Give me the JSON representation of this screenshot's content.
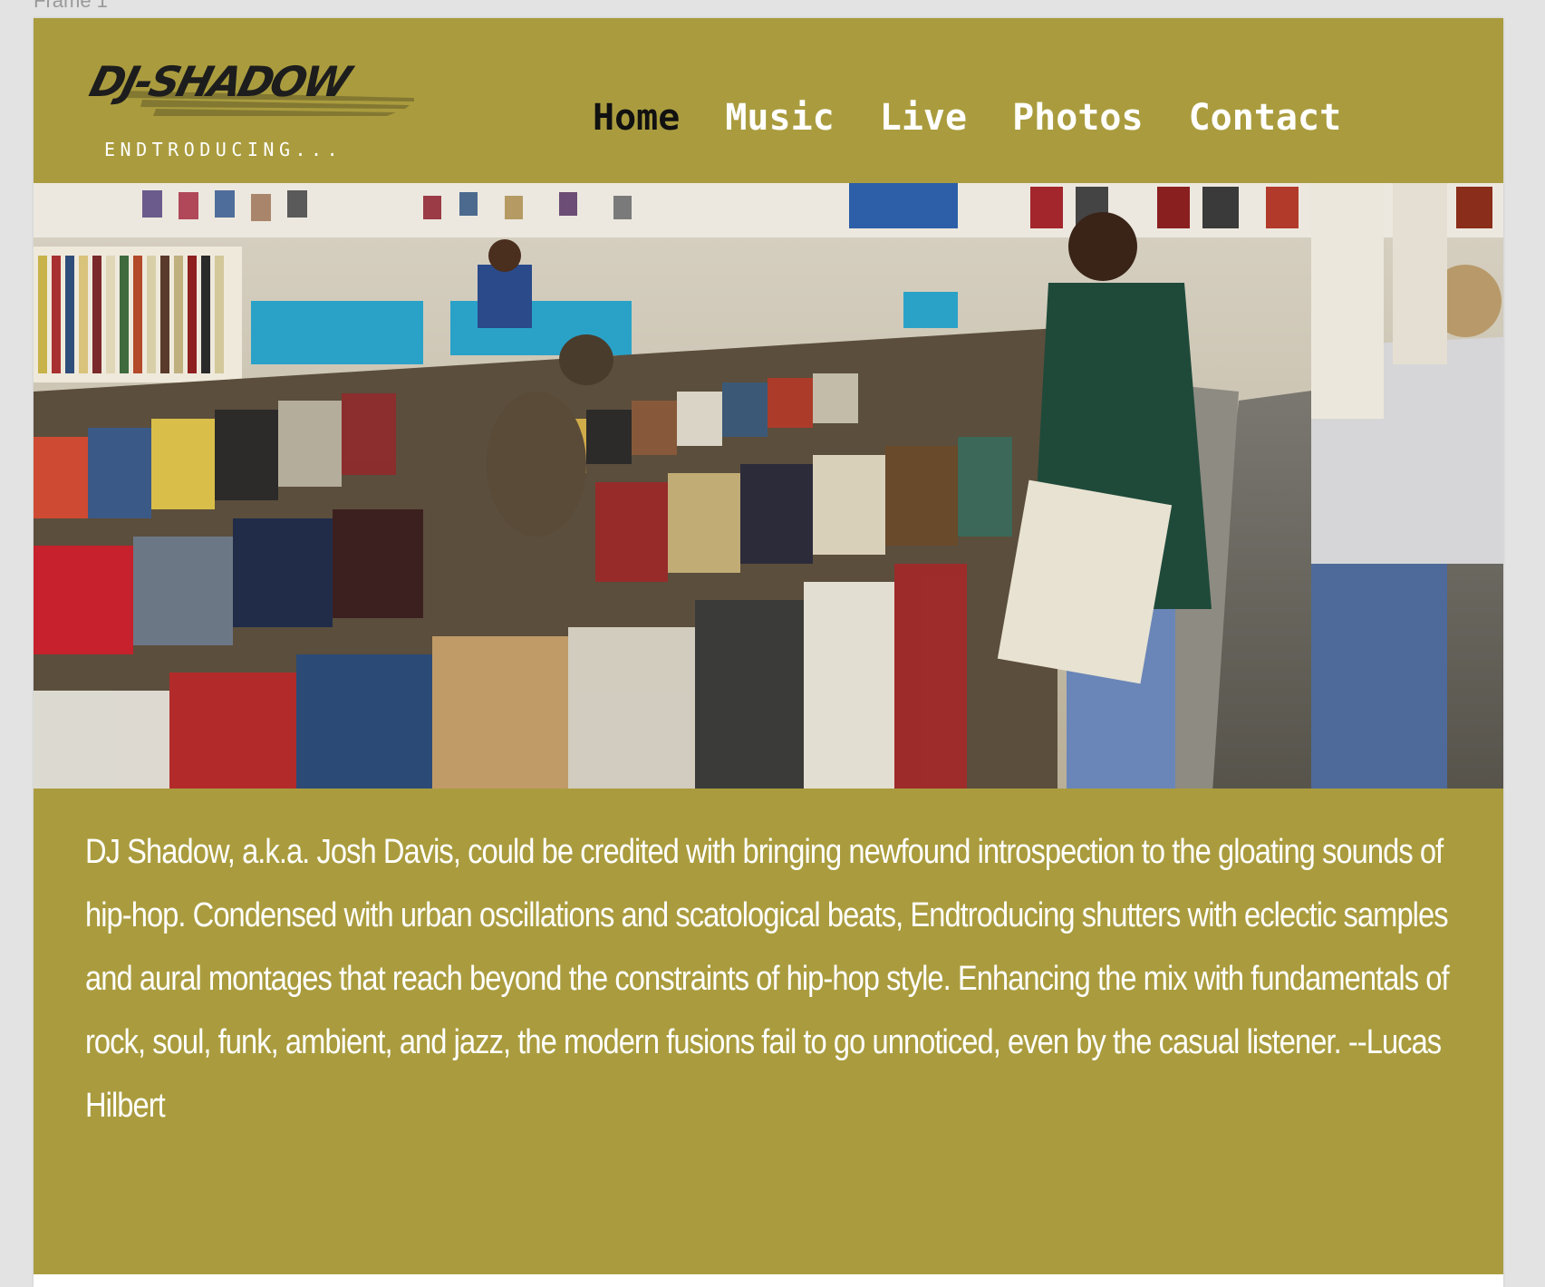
{
  "frame": {
    "label": "Frame 1"
  },
  "logo": {
    "title": "DJ-SHADOW",
    "subtitle": "ENDTRODUCING..."
  },
  "nav": {
    "items": [
      {
        "label": "Home",
        "active": true
      },
      {
        "label": "Music",
        "active": false
      },
      {
        "label": "Live",
        "active": false
      },
      {
        "label": "Photos",
        "active": false
      },
      {
        "label": "Contact",
        "active": false
      }
    ]
  },
  "hero": {
    "image_icon": "record-store-photo"
  },
  "about": {
    "text": "DJ Shadow, a.k.a. Josh Davis, could be credited with bringing newfound introspection to the gloating sounds of hip-hop. Condensed with urban oscillations and scatological beats, Endtroducing shutters with eclectic samples and aural montages that reach beyond the constraints of hip-hop style. Enhancing the mix with fundamentals of rock, soul, funk, ambient, and jazz, the modern fusions fail to go unnoticed, even by the casual listener. --Lucas Hilbert"
  },
  "colors": {
    "header_bg": "#aa9c3e",
    "nav_text": "#ffffff",
    "nav_active": "#111111",
    "page_bg": "#e3e3e3"
  }
}
